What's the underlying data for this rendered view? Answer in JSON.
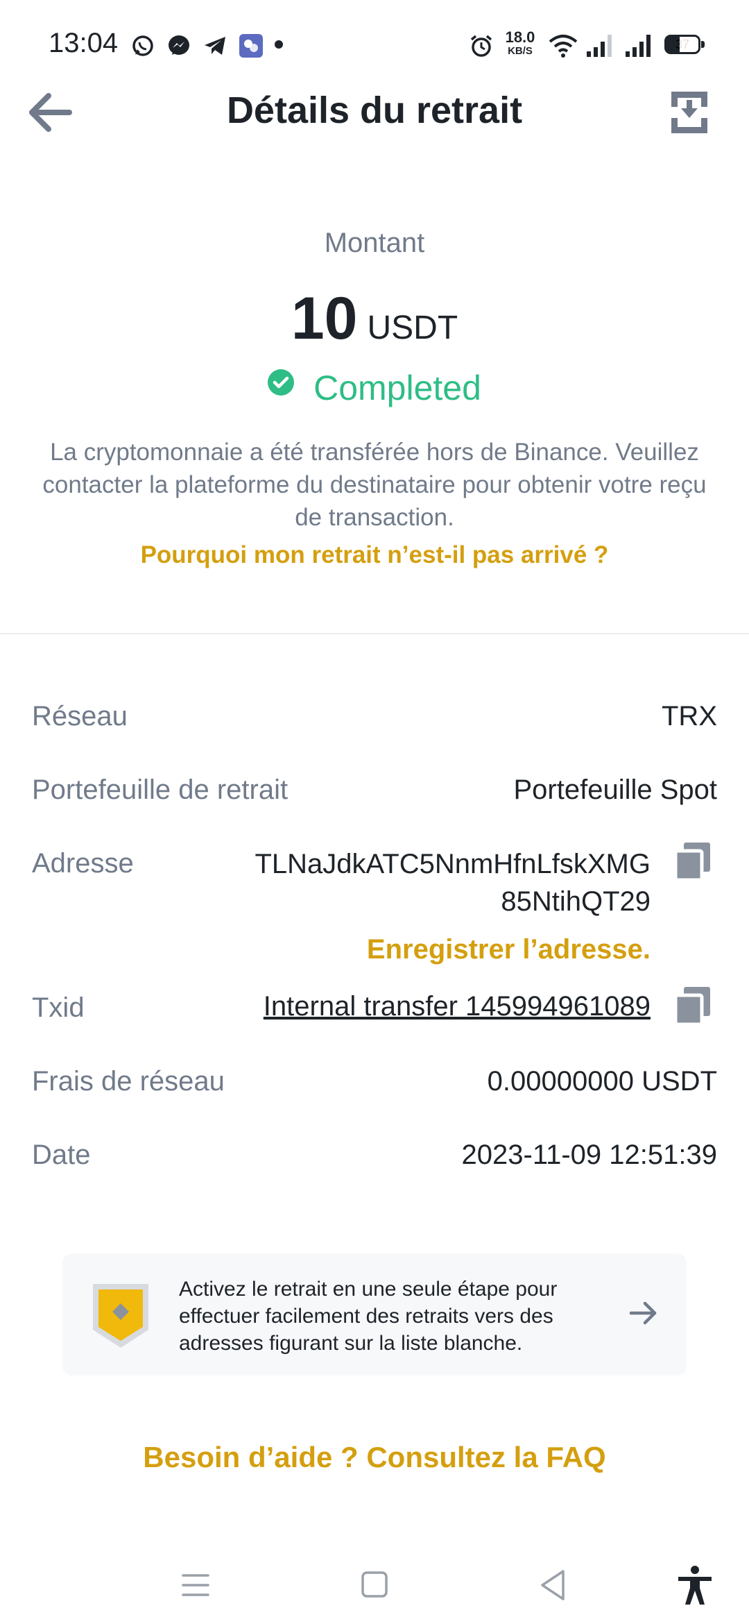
{
  "status_bar": {
    "time": "13:04",
    "net_speed_value": "18.0",
    "net_speed_unit": "KB/S",
    "battery": "37",
    "icons": [
      "whatsapp-icon",
      "messenger-icon",
      "telegram-icon",
      "app-icon",
      "alarm-icon",
      "wifi-icon",
      "signal-icon",
      "signal-icon",
      "battery-icon"
    ]
  },
  "header": {
    "title": "Détails du retrait",
    "back_icon": "arrow-left-icon",
    "download_icon": "download-icon"
  },
  "summary": {
    "amount_label": "Montant",
    "amount_value": "10",
    "amount_unit": "USDT",
    "status": "Completed",
    "status_color": "#2ebd85",
    "description": "La cryptomonnaie a été transférée hors de Binance. Veuillez contacter la plateforme du destinataire pour obtenir votre reçu de transaction.",
    "why_link": "Pourquoi mon retrait n’est-il pas arrivé ?"
  },
  "details": {
    "network_label": "Réseau",
    "network_value": "TRX",
    "wallet_label": "Portefeuille de retrait",
    "wallet_value": "Portefeuille Spot",
    "address_label": "Adresse",
    "address_line1": "TLNaJdkATC5NnmHfnLfskXMG",
    "address_line2": "85NtihQT29",
    "save_address": "Enregistrer l’adresse.",
    "txid_label": "Txid",
    "txid_value": "Internal transfer 145994961089",
    "fee_label": "Frais de réseau",
    "fee_value": "0.00000000 USDT",
    "date_label": "Date",
    "date_value": "2023-11-09 12:51:39"
  },
  "banner": {
    "text": "Activez le retrait en une seule étape pour effectuer facilement des retraits vers des adresses figurant sur la liste blanche."
  },
  "faq_link": "Besoin d’aide ? Consultez la FAQ",
  "colors": {
    "accent": "#d49f0f",
    "success": "#2ebd85",
    "muted": "#707a8a",
    "text": "#1e2329"
  }
}
